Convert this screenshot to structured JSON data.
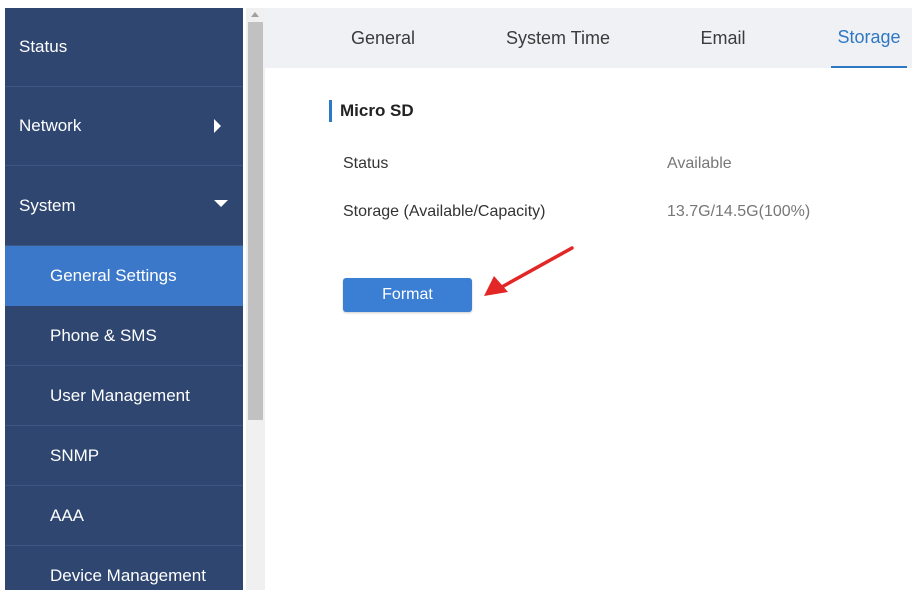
{
  "sidebar": {
    "items": [
      {
        "label": "Status"
      },
      {
        "label": "Network"
      },
      {
        "label": "System"
      }
    ],
    "system_sub": [
      {
        "label": "General Settings"
      },
      {
        "label": "Phone & SMS"
      },
      {
        "label": "User Management"
      },
      {
        "label": "SNMP"
      },
      {
        "label": "AAA"
      },
      {
        "label": "Device Management"
      }
    ],
    "active_sub": "General Settings"
  },
  "tabs": [
    {
      "label": "General"
    },
    {
      "label": "System Time"
    },
    {
      "label": "Email"
    },
    {
      "label": "Storage"
    }
  ],
  "active_tab": "Storage",
  "section": {
    "title": "Micro SD",
    "rows": [
      {
        "label": "Status",
        "value": "Available"
      },
      {
        "label": "Storage (Available/Capacity)",
        "value": "13.7G/14.5G(100%)"
      }
    ],
    "format_button": "Format"
  },
  "colors": {
    "sidebar_bg": "#2e4670",
    "active_item": "#3b78c9",
    "accent": "#2f78c4",
    "button": "#3b7fd4",
    "annotation_arrow": "#e32626"
  },
  "icons": {
    "network_caret": "caret-right-icon",
    "system_caret": "caret-down-icon",
    "annotation": "red-arrow-icon"
  }
}
